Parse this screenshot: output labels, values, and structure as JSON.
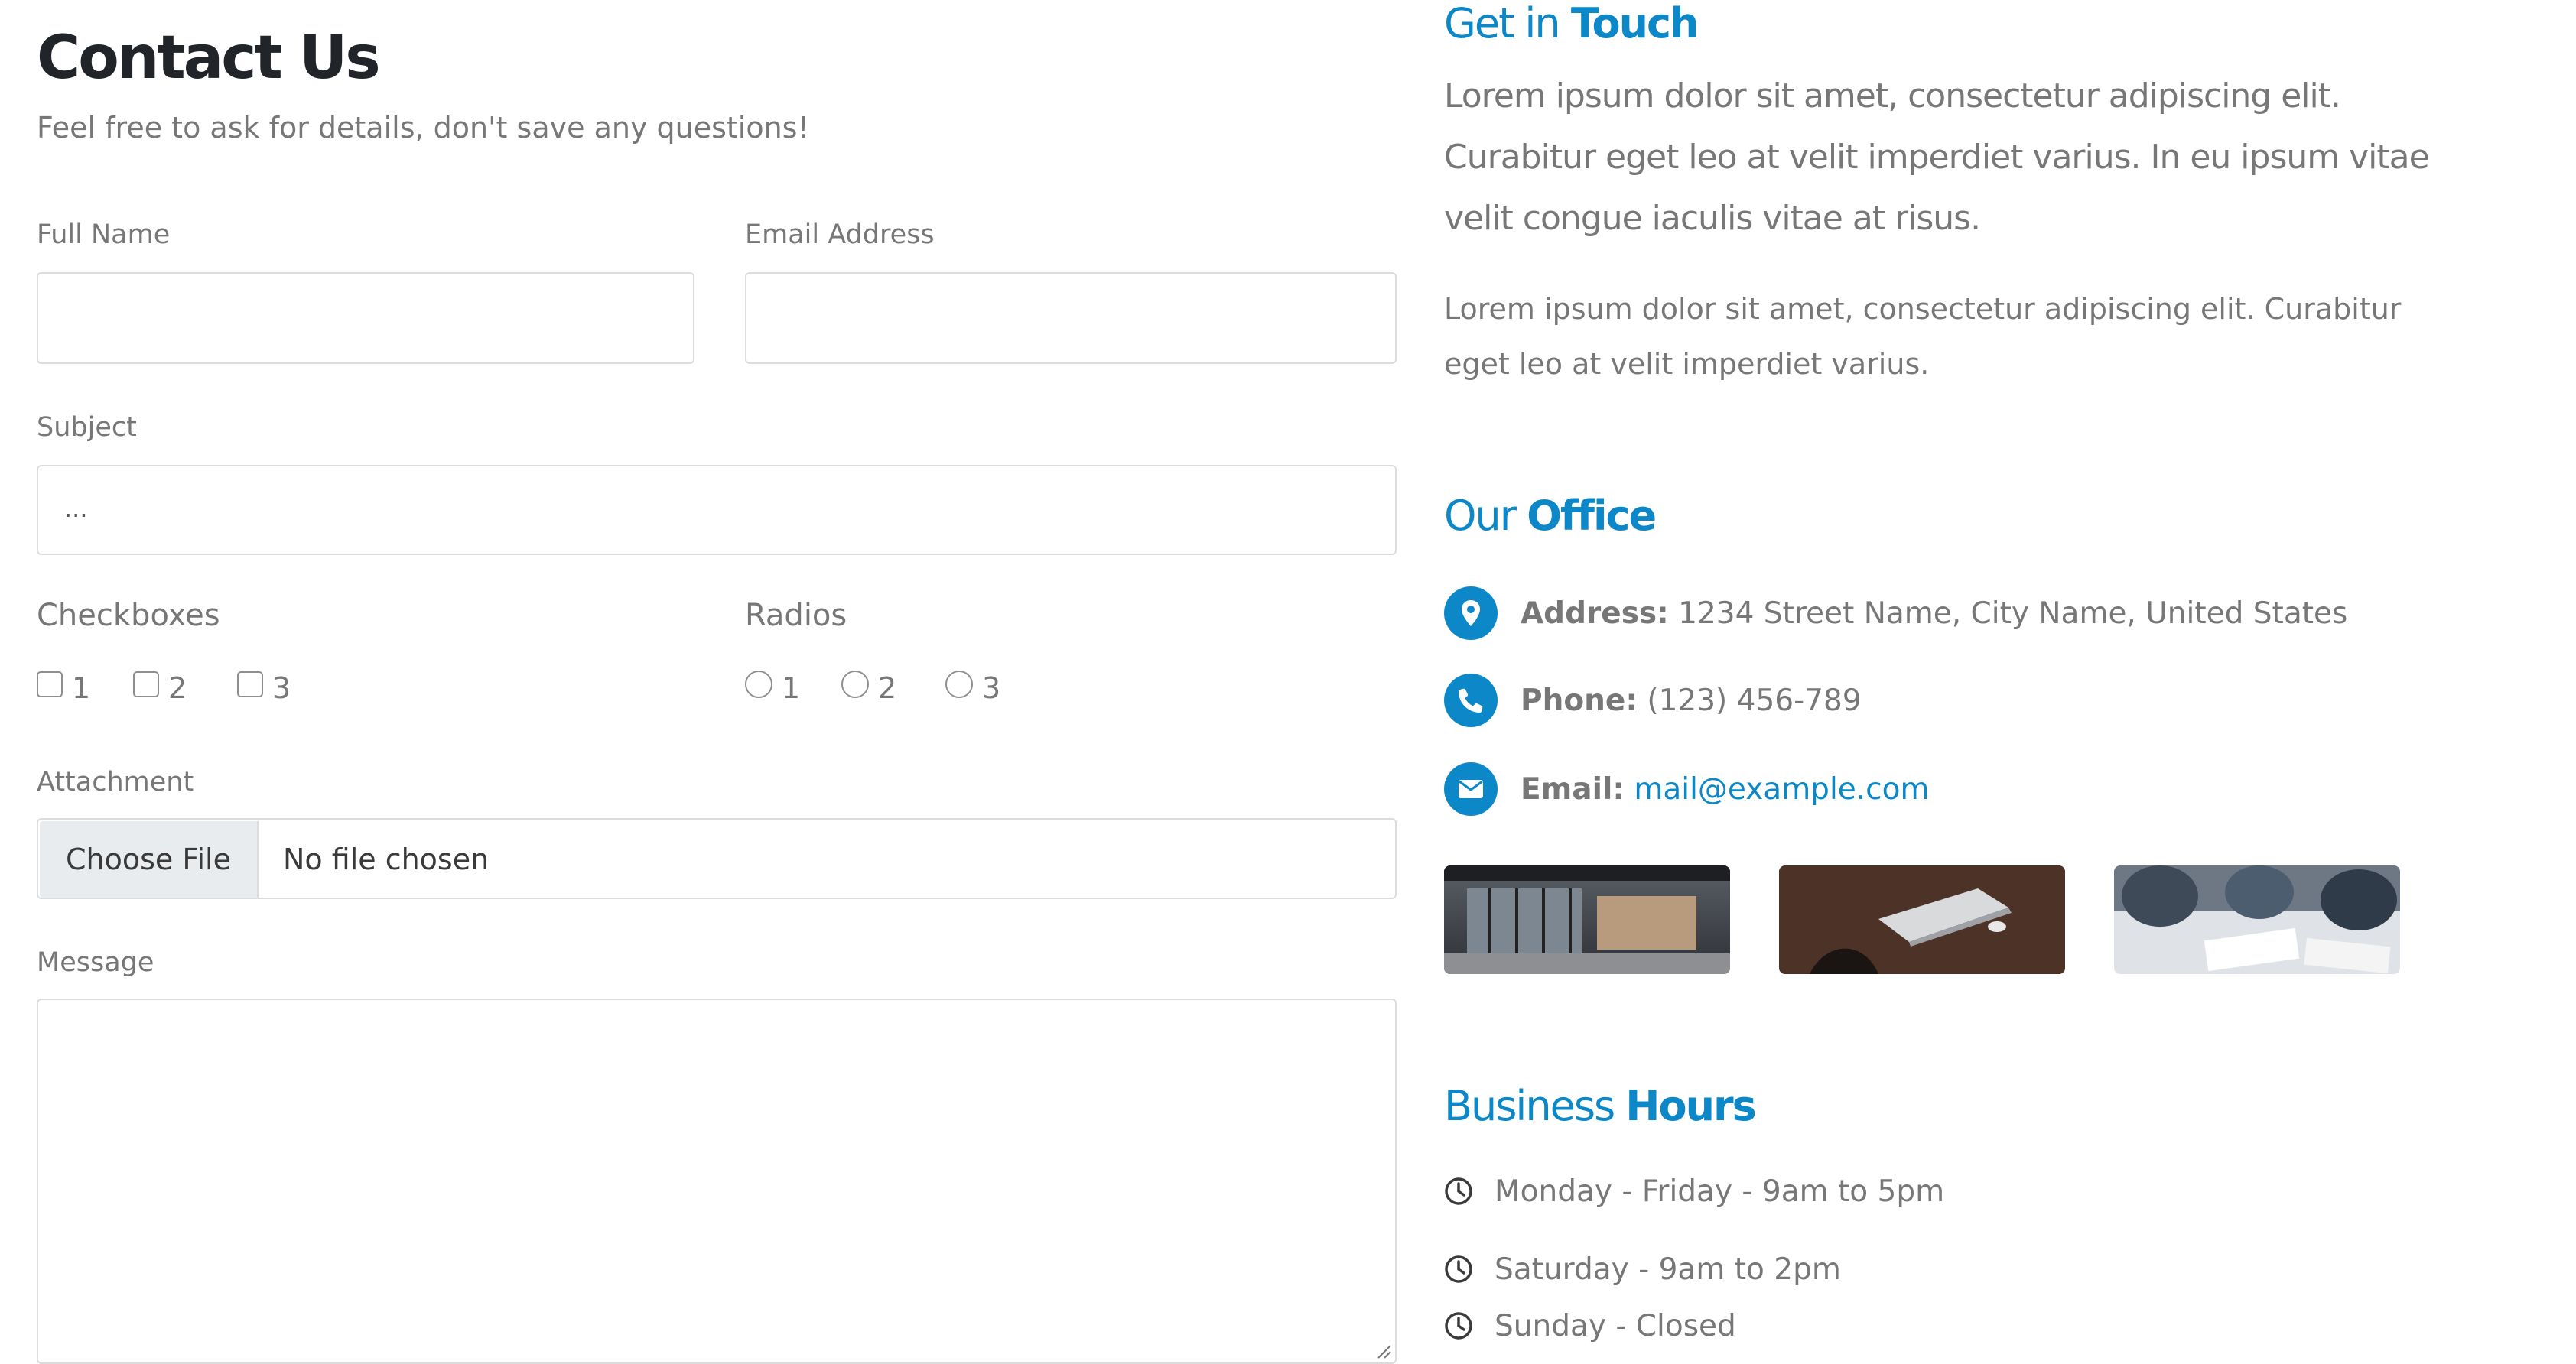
{
  "form": {
    "title": "Contact Us",
    "subtitle": "Feel free to ask for details, don't save any questions!",
    "full_name_label": "Full Name",
    "full_name_value": "",
    "email_label": "Email Address",
    "email_value": "",
    "subject_label": "Subject",
    "subject_value": "...",
    "checkboxes_label": "Checkboxes",
    "checkboxes": [
      {
        "label": "1",
        "checked": false
      },
      {
        "label": "2",
        "checked": false
      },
      {
        "label": "3",
        "checked": false
      }
    ],
    "radios_label": "Radios",
    "radios": [
      {
        "label": "1",
        "selected": false
      },
      {
        "label": "2",
        "selected": false
      },
      {
        "label": "3",
        "selected": false
      }
    ],
    "attachment_label": "Attachment",
    "choose_file_label": "Choose File",
    "file_status": "No file chosen",
    "message_label": "Message",
    "message_value": ""
  },
  "info": {
    "touch_title_light": "Get in",
    "touch_title_bold": "Touch",
    "touch_lead": "Lorem ipsum dolor sit amet, consectetur adipiscing elit. Curabitur eget leo at velit imperdiet varius. In eu ipsum vitae velit congue iaculis vitae at risus.",
    "touch_paragraph": "Lorem ipsum dolor sit amet, consectetur adipiscing elit. Curabitur eget leo at velit imperdiet varius.",
    "office_title_light": "Our",
    "office_title_bold": "Office",
    "address_label": "Address:",
    "address_value": "1234 Street Name, City Name, United States",
    "phone_label": "Phone:",
    "phone_value": "(123) 456-789",
    "email_label": "Email:",
    "email_value": "mail@example.com",
    "hours_title_light": "Business",
    "hours_title_bold": "Hours",
    "hours": [
      "Monday - Friday - 9am to 5pm",
      "Saturday - 9am to 2pm",
      "Sunday - Closed"
    ]
  },
  "icons": {
    "address": "map-marker-icon",
    "phone": "phone-icon",
    "email": "envelope-icon",
    "hours": "clock-icon"
  },
  "colors": {
    "accent": "#0c88c9",
    "heading": "#212529",
    "text": "#777777",
    "border": "#dcdcdc"
  }
}
